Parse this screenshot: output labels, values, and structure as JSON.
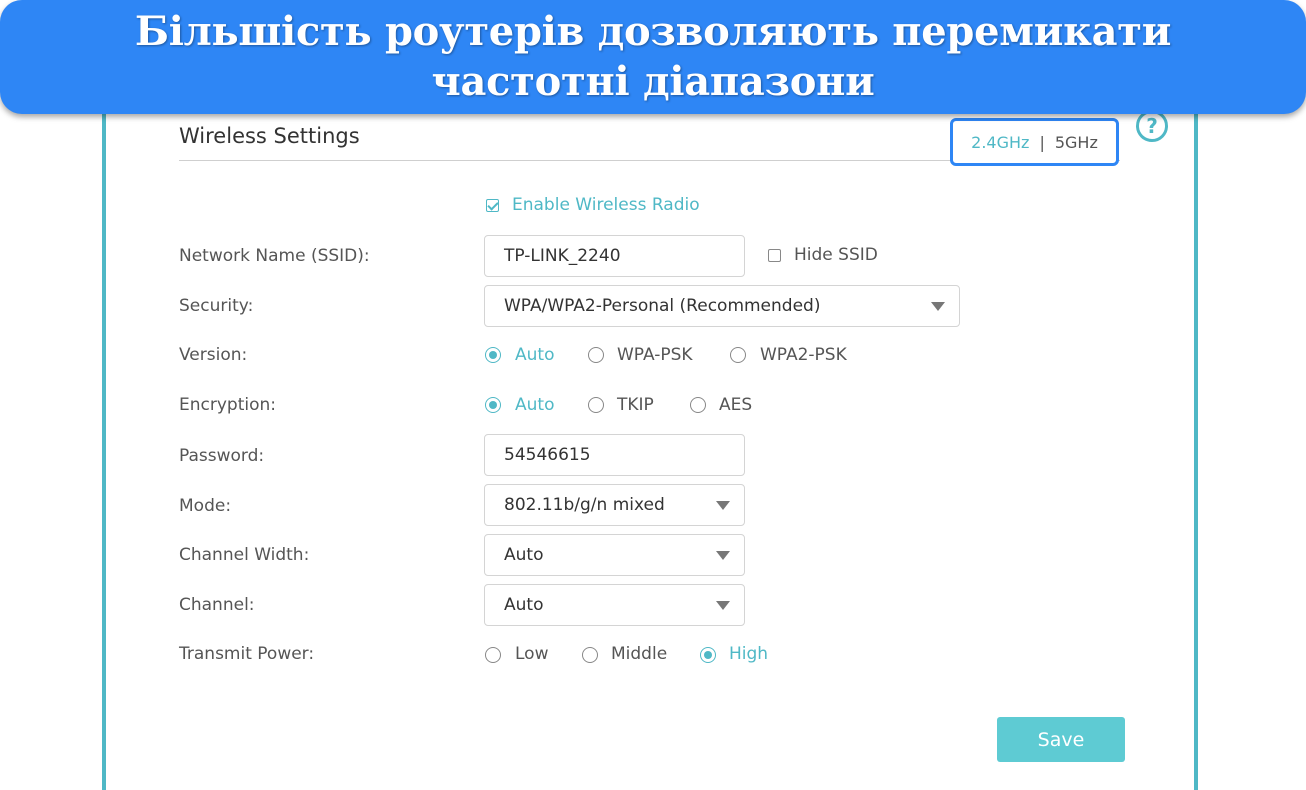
{
  "banner": {
    "line1": "Більшість роутерів дозволяють перемикати",
    "line2": "частотні діапазони"
  },
  "page": {
    "title": "Wireless Settings",
    "help_icon": "question-circle-icon",
    "freq_24": "2.4GHz",
    "freq_sep": "|",
    "freq_5": "5GHz",
    "accent_color": "#4fb8c6",
    "highlight_color": "#2e86f5"
  },
  "form": {
    "enable_radio_label": "Enable Wireless Radio",
    "enable_radio_checked": true,
    "ssid_label": "Network Name (SSID):",
    "ssid_value": "TP-LINK_2240",
    "hide_ssid_label": "Hide SSID",
    "hide_ssid_checked": false,
    "security_label": "Security:",
    "security_value": "WPA/WPA2-Personal (Recommended)",
    "version_label": "Version:",
    "version_options": [
      "Auto",
      "WPA-PSK",
      "WPA2-PSK"
    ],
    "version_selected": "Auto",
    "encryption_label": "Encryption:",
    "encryption_options": [
      "Auto",
      "TKIP",
      "AES"
    ],
    "encryption_selected": "Auto",
    "password_label": "Password:",
    "password_value": "54546615",
    "mode_label": "Mode:",
    "mode_value": "802.11b/g/n mixed",
    "channel_width_label": "Channel Width:",
    "channel_width_value": "Auto",
    "channel_label": "Channel:",
    "channel_value": "Auto",
    "transmit_label": "Transmit Power:",
    "transmit_options": [
      "Low",
      "Middle",
      "High"
    ],
    "transmit_selected": "High",
    "save_label": "Save"
  }
}
